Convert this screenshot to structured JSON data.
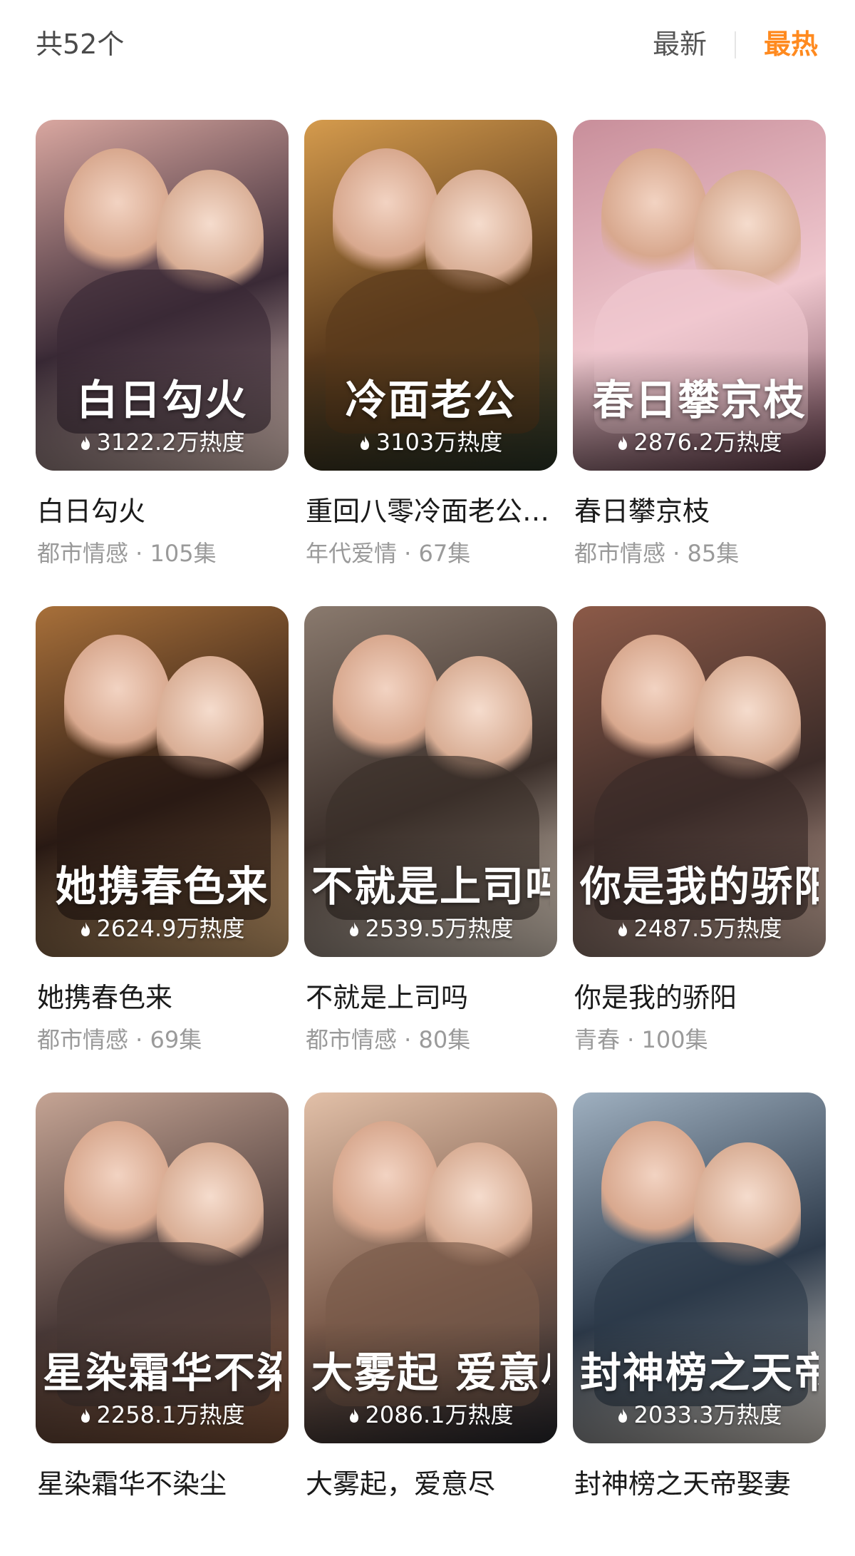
{
  "header": {
    "count_label": "共52个",
    "sort_newest": "最新",
    "sort_hottest": "最热",
    "active_sort": "最热",
    "accent_color": "#ff8a1f"
  },
  "dramas": [
    {
      "title": "白日勾火",
      "poster_title": "白日勾火",
      "heat": "3122.2万热度",
      "genre": "都市情感",
      "episodes": "105集",
      "meta": "都市情感 · 105集"
    },
    {
      "title": "重回八零冷面老公……",
      "poster_title": "冷面老公",
      "heat": "3103万热度",
      "genre": "年代爱情",
      "episodes": "67集",
      "meta": "年代爱情 · 67集"
    },
    {
      "title": "春日攀京枝",
      "poster_title": "春日攀京枝",
      "heat": "2876.2万热度",
      "genre": "都市情感",
      "episodes": "85集",
      "meta": "都市情感 · 85集"
    },
    {
      "title": "她携春色来",
      "poster_title": "她携春色来",
      "heat": "2624.9万热度",
      "genre": "都市情感",
      "episodes": "69集",
      "meta": "都市情感 · 69集"
    },
    {
      "title": "不就是上司吗",
      "poster_title": "不就是上司吗",
      "heat": "2539.5万热度",
      "genre": "都市情感",
      "episodes": "80集",
      "meta": "都市情感 · 80集"
    },
    {
      "title": "你是我的骄阳",
      "poster_title": "你是我的骄阳",
      "heat": "2487.5万热度",
      "genre": "青春",
      "episodes": "100集",
      "meta": "青春 · 100集"
    },
    {
      "title": "星染霜华不染尘",
      "poster_title": "星染霜华不染尘",
      "heat": "2258.1万热度",
      "genre": "",
      "episodes": "",
      "meta": ""
    },
    {
      "title": "大雾起，爱意尽",
      "poster_title": "大雾起 爱意尽",
      "heat": "2086.1万热度",
      "genre": "",
      "episodes": "",
      "meta": ""
    },
    {
      "title": "封神榜之天帝娶妻",
      "poster_title": "封神榜之天帝娶妻",
      "heat": "2033.3万热度",
      "genre": "",
      "episodes": "",
      "meta": ""
    }
  ]
}
